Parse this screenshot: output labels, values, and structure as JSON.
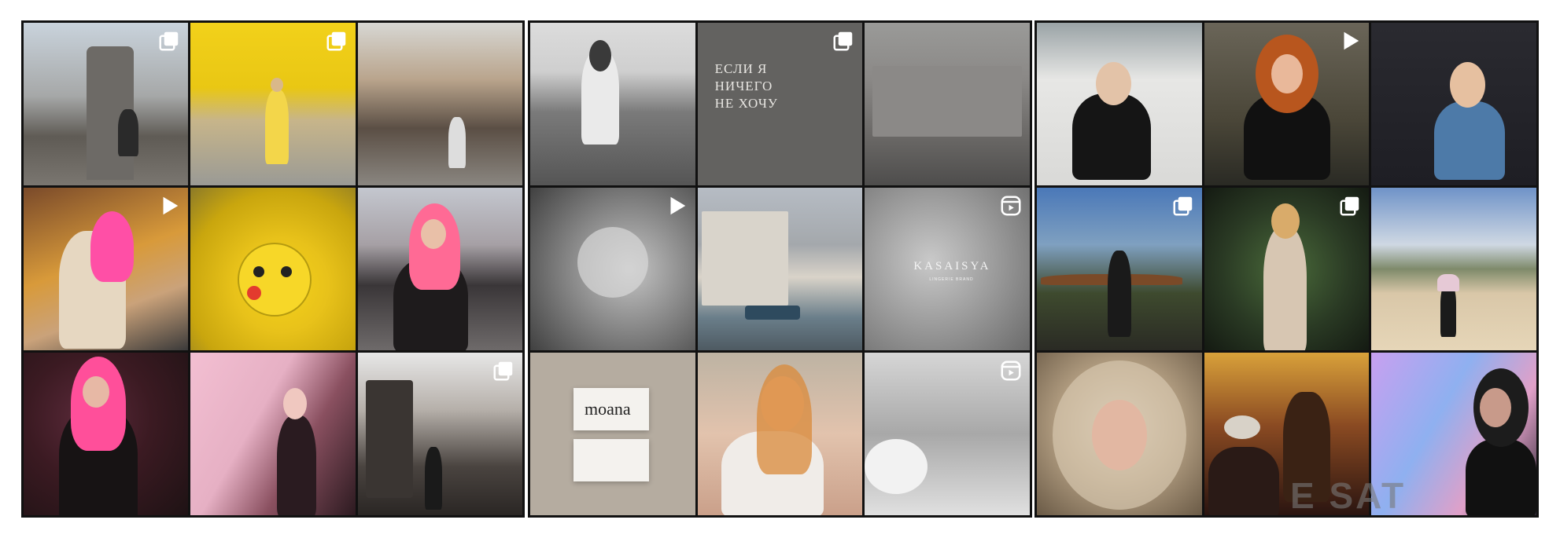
{
  "panels": [
    {
      "name": "grid-pink-hair-tokyo",
      "tiles": [
        {
          "badge": "multi"
        },
        {
          "badge": "multi"
        },
        {
          "badge": null
        },
        {
          "badge": "video"
        },
        {
          "badge": null
        },
        {
          "badge": null
        },
        {
          "badge": null
        },
        {
          "badge": null
        },
        {
          "badge": "multi"
        }
      ]
    },
    {
      "name": "grid-monochrome-brand",
      "tiles": [
        {
          "badge": null
        },
        {
          "badge": "multi",
          "caption": "ЕСЛИ Я\nНИЧЕГО\nНЕ ХОЧУ"
        },
        {
          "badge": null
        },
        {
          "badge": "video"
        },
        {
          "badge": null
        },
        {
          "badge": "reel",
          "caption": "KASAISYA",
          "subcaption": "LINGERIE BRAND"
        },
        {
          "badge": null,
          "caption": "moana"
        },
        {
          "badge": null
        },
        {
          "badge": "reel"
        }
      ]
    },
    {
      "name": "grid-portraits",
      "tiles": [
        {
          "badge": null
        },
        {
          "badge": "video"
        },
        {
          "badge": null
        },
        {
          "badge": "multi"
        },
        {
          "badge": "multi"
        },
        {
          "badge": null
        },
        {
          "badge": null
        },
        {
          "badge": null
        },
        {
          "badge": null
        }
      ]
    }
  ],
  "watermark": "E SAT",
  "colors": {
    "frame": "#111111",
    "background": "#ffffff",
    "icon": "#ffffff"
  }
}
